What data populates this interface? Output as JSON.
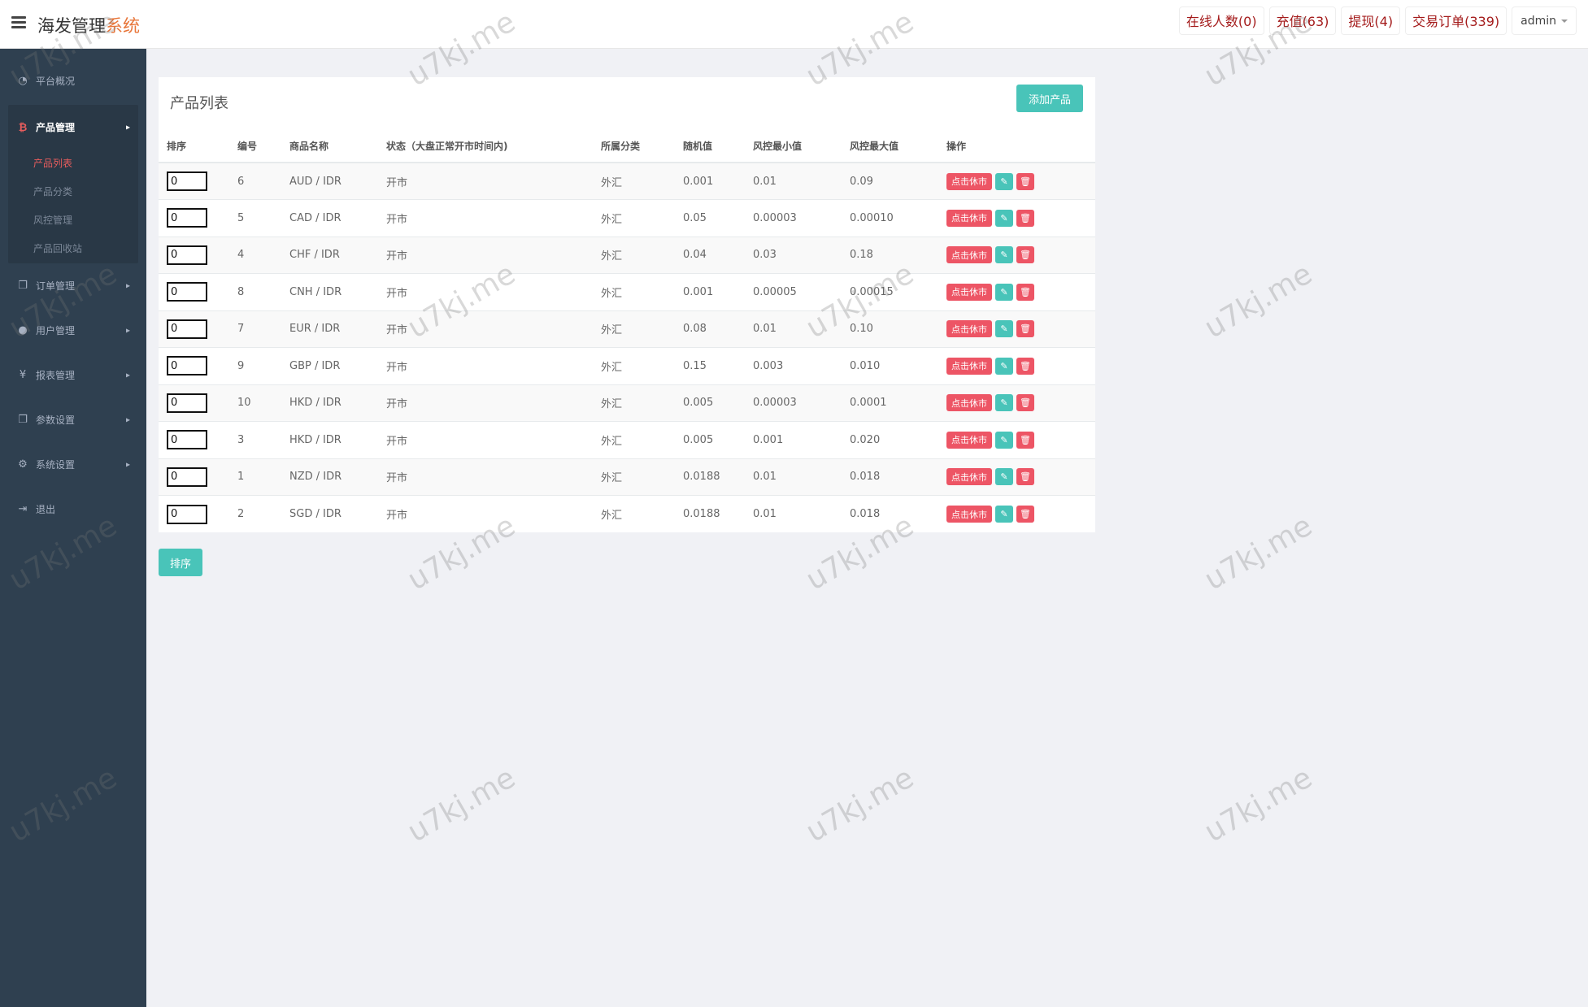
{
  "app": {
    "title_main": "海发管理",
    "title_accent": "系统"
  },
  "topnav": [
    {
      "label": "在线人数(0)"
    },
    {
      "label": "充值(63)"
    },
    {
      "label": "提现(4)"
    },
    {
      "label": "交易订单(339)"
    }
  ],
  "user": {
    "name": "admin"
  },
  "sidebar": {
    "items": [
      {
        "label": "平台概况",
        "icon": "dashboard-icon"
      },
      {
        "label": "产品管理",
        "icon": "bitcoin-icon",
        "active": true,
        "children": [
          {
            "label": "产品列表",
            "active": true
          },
          {
            "label": "产品分类"
          },
          {
            "label": "风控管理"
          },
          {
            "label": "产品回收站"
          }
        ]
      },
      {
        "label": "订单管理",
        "icon": "copy-icon"
      },
      {
        "label": "用户管理",
        "icon": "user-icon"
      },
      {
        "label": "报表管理",
        "icon": "yen-icon"
      },
      {
        "label": "参数设置",
        "icon": "copy-icon"
      },
      {
        "label": "系统设置",
        "icon": "cogs-icon"
      },
      {
        "label": "退出",
        "icon": "sign-out-icon"
      }
    ]
  },
  "card": {
    "title": "产品列表",
    "add_button": "添加产品"
  },
  "table": {
    "headers": [
      "排序",
      "编号",
      "商品名称",
      "状态（大盘正常开市时间内)",
      "所属分类",
      "随机值",
      "风控最小值",
      "风控最大值",
      "操作"
    ],
    "rows": [
      {
        "sort": "0",
        "id": "6",
        "name": "AUD / IDR",
        "status": "开市",
        "category": "外汇",
        "random": "0.001",
        "min": "0.01",
        "max": "0.09",
        "action": "点击休市"
      },
      {
        "sort": "0",
        "id": "5",
        "name": "CAD / IDR",
        "status": "开市",
        "category": "外汇",
        "random": "0.05",
        "min": "0.00003",
        "max": "0.00010",
        "action": "点击休市"
      },
      {
        "sort": "0",
        "id": "4",
        "name": "CHF / IDR",
        "status": "开市",
        "category": "外汇",
        "random": "0.04",
        "min": "0.03",
        "max": "0.18",
        "action": "点击休市"
      },
      {
        "sort": "0",
        "id": "8",
        "name": "CNH / IDR",
        "status": "开市",
        "category": "外汇",
        "random": "0.001",
        "min": "0.00005",
        "max": "0.00015",
        "action": "点击休市"
      },
      {
        "sort": "0",
        "id": "7",
        "name": "EUR / IDR",
        "status": "开市",
        "category": "外汇",
        "random": "0.08",
        "min": "0.01",
        "max": "0.10",
        "action": "点击休市"
      },
      {
        "sort": "0",
        "id": "9",
        "name": "GBP / IDR",
        "status": "开市",
        "category": "外汇",
        "random": "0.15",
        "min": "0.003",
        "max": "0.010",
        "action": "点击休市"
      },
      {
        "sort": "0",
        "id": "10",
        "name": "HKD / IDR",
        "status": "开市",
        "category": "外汇",
        "random": "0.005",
        "min": "0.00003",
        "max": "0.0001",
        "action": "点击休市"
      },
      {
        "sort": "0",
        "id": "3",
        "name": "HKD / IDR",
        "status": "开市",
        "category": "外汇",
        "random": "0.005",
        "min": "0.001",
        "max": "0.020",
        "action": "点击休市"
      },
      {
        "sort": "0",
        "id": "1",
        "name": "NZD / IDR",
        "status": "开市",
        "category": "外汇",
        "random": "0.0188",
        "min": "0.01",
        "max": "0.018",
        "action": "点击休市"
      },
      {
        "sort": "0",
        "id": "2",
        "name": "SGD / IDR",
        "status": "开市",
        "category": "外汇",
        "random": "0.0188",
        "min": "0.01",
        "max": "0.018",
        "action": "点击休市"
      }
    ]
  },
  "sort_button": "排序",
  "watermark": "u7kj.me",
  "colors": {
    "teal": "#49c4b9",
    "red": "#ed5565",
    "sidebar": "#2f4050",
    "nav_text": "#a41b1b",
    "brand_accent": "#e8763a"
  }
}
